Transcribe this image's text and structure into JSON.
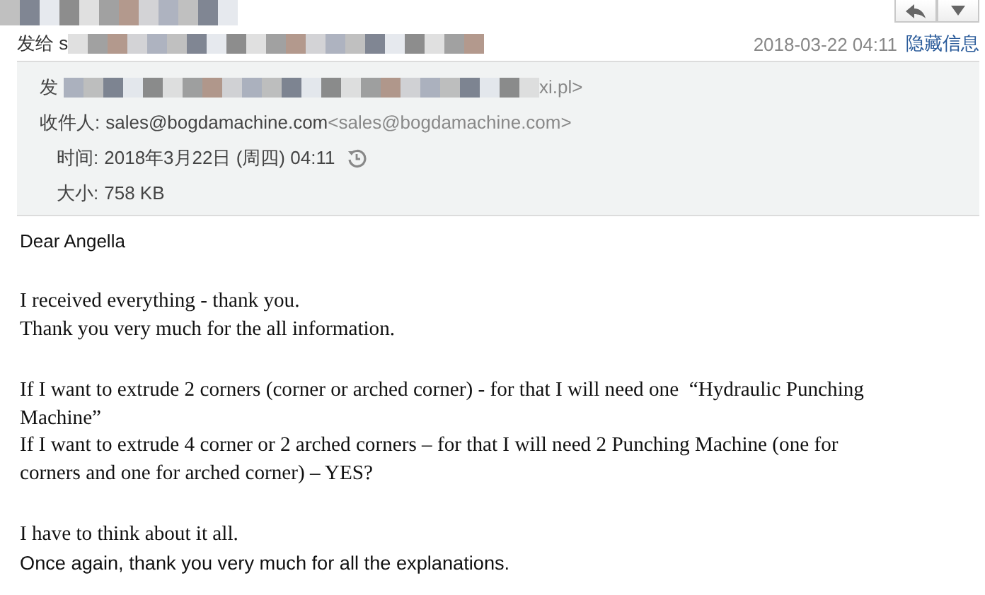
{
  "header": {
    "recipient_prefix": "发给 s",
    "date": "2018-03-22 04:11",
    "hide_link": "隐藏信息"
  },
  "details": {
    "from_label": "发",
    "from_tail": "xi.pl>",
    "to_label": "收件人:",
    "to_name": "sales@bogdamachine.com",
    "to_address": "<sales@bogdamachine.com>",
    "time_label": "时间:",
    "time_value": "2018年3月22日 (周四) 04:11",
    "size_label": "大小:",
    "size_value": "758 KB"
  },
  "body": [
    {
      "lines": [
        {
          "kind": "sans",
          "text": "Dear Angella"
        }
      ]
    },
    {
      "lines": [
        {
          "kind": "serif",
          "text": "I received everything - thank you."
        },
        {
          "kind": "serif",
          "text": "Thank you very much for the all information."
        }
      ]
    },
    {
      "lines": [
        {
          "kind": "serif",
          "text": "If I want to extrude 2 corners (corner or arched corner) - for that I will need one  “Hydraulic Punching"
        },
        {
          "kind": "serif",
          "text": "Machine”"
        },
        {
          "kind": "serif",
          "text": "If I want to extrude 4 corner or 2 arched corners – for that I will need 2 Punching Machine (one for"
        },
        {
          "kind": "serif",
          "text": "corners and one for arched corner) – YES?"
        }
      ]
    },
    {
      "lines": [
        {
          "kind": "serif",
          "text": "I have to think about it all."
        },
        {
          "kind": "sans",
          "text": "Once again, thank you very much for all the explanations."
        }
      ]
    }
  ]
}
